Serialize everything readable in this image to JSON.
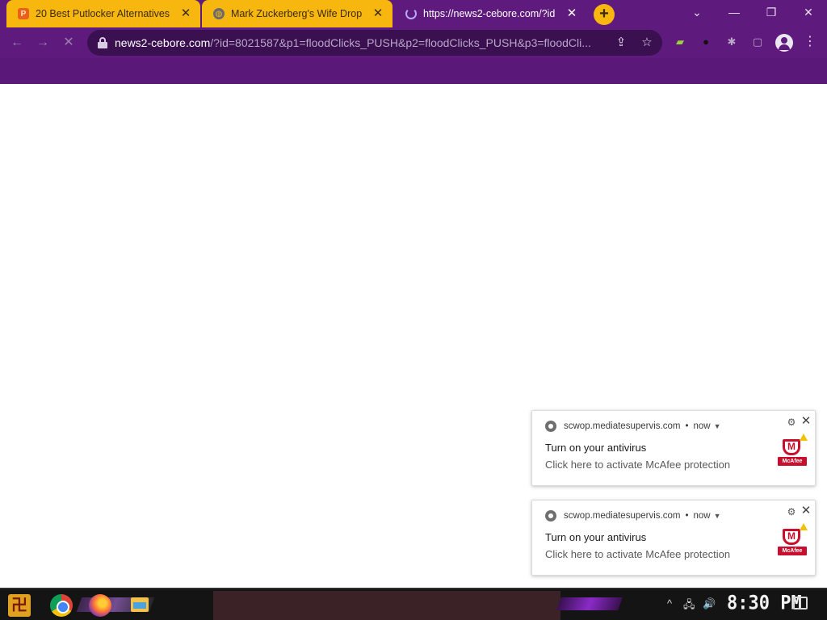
{
  "browser": {
    "tabs": [
      {
        "title": "20 Best Putlocker Alternatives",
        "favicon": "putlocker-favicon",
        "active": false
      },
      {
        "title": "Mark Zuckerberg's Wife Drop",
        "favicon": "globe-favicon",
        "active": false
      },
      {
        "title": "https://news2-cebore.com/?id",
        "favicon": "loading-spinner",
        "active": true
      }
    ],
    "new_tab_label": "+",
    "close_glyph": "✕",
    "window_controls": {
      "tab_search": "⌄",
      "minimize": "—",
      "restore": "❐",
      "close": "✕"
    },
    "nav": {
      "back": "←",
      "forward": "→",
      "stop": "✕"
    },
    "address": {
      "host": "news2-cebore.com",
      "path": "/?id=8021587&p1=floodClicks_PUSH&p2=floodClicks_PUSH&p3=floodCli..."
    },
    "omnibox_icons": {
      "share": "⇪",
      "bookmark": "☆"
    },
    "extensions": {
      "bag": "▰",
      "dark_circle": "●",
      "puzzle": "✱",
      "sidebar": "▢",
      "menu": "⋮"
    }
  },
  "notifications": [
    {
      "origin": "scwop.mediatesupervis.com",
      "time": "now",
      "title": "Turn on your antivirus",
      "body": "Click here to activate McAfee protection",
      "brand": "McAfee"
    },
    {
      "origin": "scwop.mediatesupervis.com",
      "time": "now",
      "title": "Turn on your antivirus",
      "body": "Click here to activate McAfee protection",
      "brand": "McAfee"
    }
  ],
  "taskbar": {
    "start_glyph": "卍",
    "clock": "8:30 PM",
    "tray": {
      "chevron": "^",
      "network": "🖧",
      "volume": "🔊"
    }
  },
  "colors": {
    "browser_frame": "#5e1a7c",
    "tab_inactive": "#f7b70f",
    "mcafee_red": "#c8102e"
  }
}
